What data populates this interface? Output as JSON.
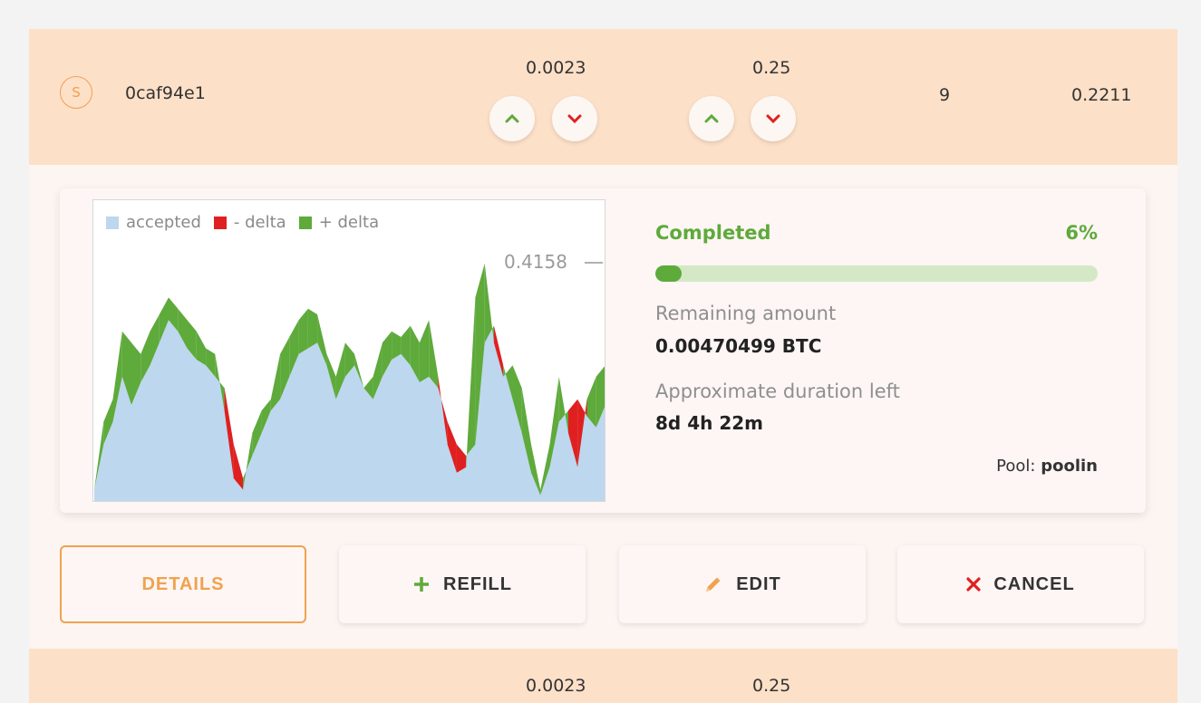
{
  "order": {
    "badge": "S",
    "id": "0caf94e1",
    "price": "0.0023",
    "limit": "0.25",
    "count": "9",
    "total": "0.2211"
  },
  "chart_data": {
    "type": "area",
    "legend": [
      "accepted",
      "- delta",
      "+ delta"
    ],
    "colors": {
      "accepted": "#bdd7ee",
      "minus_delta": "#e02020",
      "plus_delta": "#5eaa3b"
    },
    "max_label": "0.4158",
    "ylim": [
      0,
      0.5
    ],
    "series": [
      {
        "name": "accepted",
        "values": [
          0.02,
          0.1,
          0.14,
          0.22,
          0.17,
          0.21,
          0.24,
          0.28,
          0.32,
          0.3,
          0.27,
          0.25,
          0.24,
          0.22,
          0.2,
          0.1,
          0.04,
          0.08,
          0.12,
          0.16,
          0.18,
          0.22,
          0.26,
          0.27,
          0.28,
          0.24,
          0.18,
          0.22,
          0.24,
          0.2,
          0.18,
          0.22,
          0.25,
          0.26,
          0.24,
          0.21,
          0.22,
          0.2,
          0.14,
          0.1,
          0.08,
          0.1,
          0.28,
          0.31,
          0.24,
          0.18,
          0.12,
          0.05,
          0.01,
          0.06,
          0.14,
          0.16,
          0.18,
          0.15,
          0.13,
          0.17
        ]
      },
      {
        "name": "line",
        "values": [
          0.02,
          0.14,
          0.18,
          0.3,
          0.28,
          0.26,
          0.3,
          0.33,
          0.36,
          0.34,
          0.32,
          0.3,
          0.27,
          0.26,
          0.16,
          0.04,
          0.02,
          0.12,
          0.16,
          0.18,
          0.26,
          0.29,
          0.32,
          0.34,
          0.33,
          0.26,
          0.22,
          0.28,
          0.26,
          0.2,
          0.22,
          0.28,
          0.3,
          0.29,
          0.31,
          0.28,
          0.32,
          0.22,
          0.1,
          0.05,
          0.06,
          0.36,
          0.42,
          0.28,
          0.22,
          0.24,
          0.2,
          0.1,
          0.02,
          0.1,
          0.22,
          0.12,
          0.06,
          0.18,
          0.22,
          0.24
        ]
      }
    ]
  },
  "progress": {
    "title": "Completed",
    "percent_label": "6%",
    "percent": 6
  },
  "info": {
    "remaining_label": "Remaining amount",
    "remaining_value": "0.00470499 BTC",
    "duration_label": "Approximate duration left",
    "duration_value": "8d 4h 22m",
    "pool_label": "Pool:",
    "pool_value": "poolin"
  },
  "buttons": {
    "details": "DETAILS",
    "refill": "REFILL",
    "edit": "EDIT",
    "cancel": "CANCEL"
  },
  "next_order": {
    "price": "0.0023",
    "limit": "0.25"
  }
}
